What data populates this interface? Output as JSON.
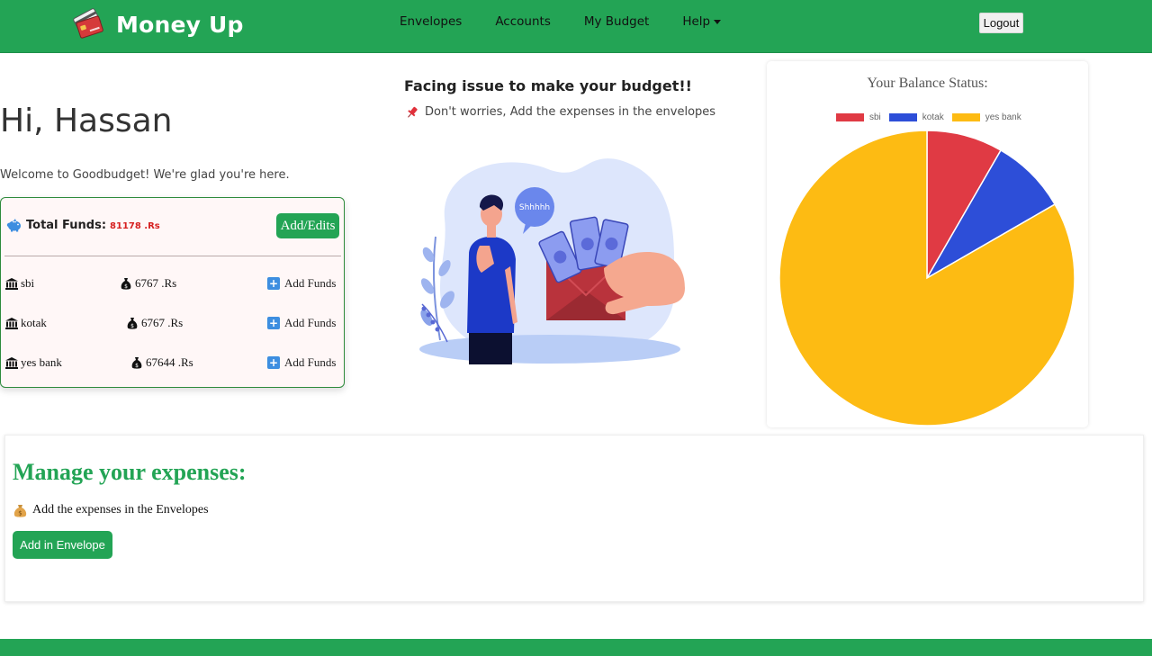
{
  "brand": {
    "name": "Money Up",
    "logo_icon": "credit-cards-icon"
  },
  "nav": {
    "items": [
      {
        "label": "Envelopes"
      },
      {
        "label": "Accounts"
      },
      {
        "label": "My Budget"
      },
      {
        "label": "Help",
        "dropdown": true
      }
    ],
    "logout_label": "Logout"
  },
  "greeting": "Hi, Hassan",
  "welcome_text": "Welcome to Goodbudget! We're glad you're here.",
  "funds": {
    "label": "Total Funds:",
    "value": "81178 .Rs",
    "edit_label": "Add/Edits",
    "add_funds_label": "Add Funds",
    "accounts": [
      {
        "name": "sbi",
        "amount": "6767 .Rs"
      },
      {
        "name": "kotak",
        "amount": "6767 .Rs"
      },
      {
        "name": "yes bank",
        "amount": "67644 .Rs"
      }
    ]
  },
  "tips": {
    "title": "Facing issue to make your budget!!",
    "subtitle": "Don't worries, Add the expenses in the envelopes",
    "speech_text": "Shhhhh"
  },
  "chart_data": {
    "type": "pie",
    "title": "Your Balance Status:",
    "legend_position": "top",
    "categories": [
      "sbi",
      "kotak",
      "yes bank"
    ],
    "values": [
      6767,
      6767,
      67644
    ],
    "colors": [
      "#e03a44",
      "#2d4ed8",
      "#fdbb13"
    ]
  },
  "manage": {
    "title": "Manage your expenses:",
    "subtitle": "Add the expenses in the Envelopes",
    "button_label": "Add in Envelope"
  },
  "colors": {
    "primary": "#23a455",
    "funds_value": "#d62020"
  }
}
